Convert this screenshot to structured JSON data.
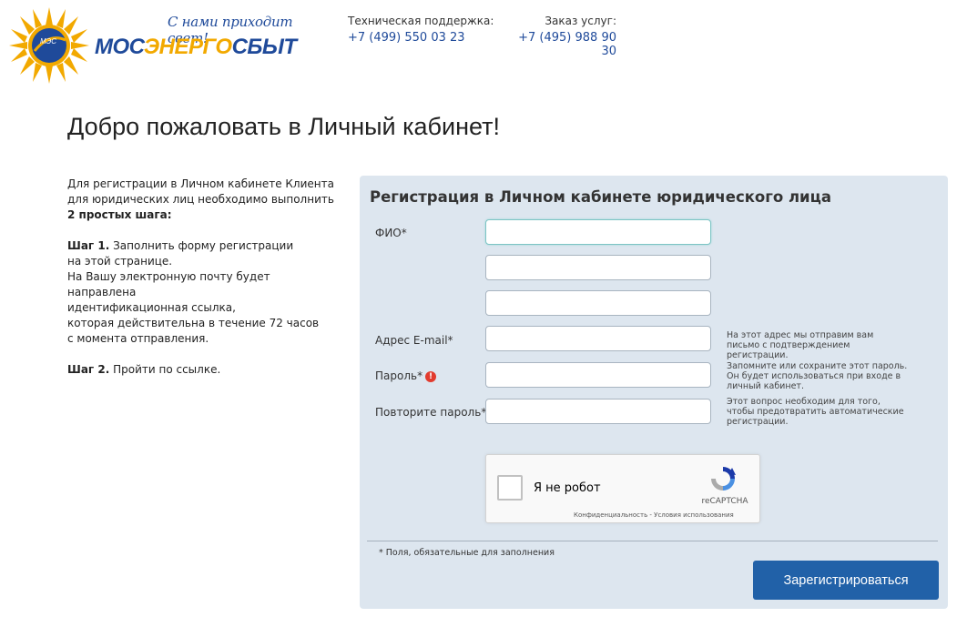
{
  "header": {
    "logo_emblem_text": "МЭС",
    "slogan": "С нами приходит свет!",
    "brand": {
      "part1": "МОС",
      "part2": "ЭНЕРГО",
      "part3": "СБЫТ"
    },
    "support": {
      "label": "Техническая поддержка:",
      "phone": "+7 (499) 550 03 23"
    },
    "order": {
      "label": "Заказ услуг:",
      "phone": "+7 (495) 988 90 30"
    }
  },
  "page_title": "Добро пожаловать в Личный кабинет!",
  "intro": {
    "line1": "Для регистрации в Личном кабинете Клиента",
    "line2": "для юридических лиц необходимо выполнить",
    "line3": "2 простых шага:",
    "step1_label": "Шаг 1.",
    "step1_text1": " Заполнить форму регистрации",
    "step1_text2": "на этой странице.",
    "step1_text3": "На Вашу электронную почту будет направлена",
    "step1_text4": "идентификационная ссылка,",
    "step1_text5": "которая действительна в течение 72 часов",
    "step1_text6": "с момента отправления.",
    "step2_label": "Шаг 2.",
    "step2_text": " Пройти по ссылке."
  },
  "form": {
    "title": "Регистрация в Личном кабинете юридического лица",
    "fio_label": "ФИО*",
    "fio_value": "",
    "fio2_value": "",
    "fio3_value": "",
    "email_label": "Адрес E-mail*",
    "email_value": "",
    "email_hint": "На этот адрес мы отправим вам письмо с подтверждением регистрации.",
    "password_label": "Пароль*",
    "password_value": "",
    "password_hint": "Запомните или сохраните этот пароль. Он будет использоваться при входе в личный кабинет.",
    "password_repeat_label": "Повторите пароль*",
    "password_repeat_value": "",
    "password_repeat_hint": "Этот вопрос необходим для того, чтобы предотвратить автоматические регистрации.",
    "captcha_label": "Я не робот",
    "captcha_brand": "reCAPTCHA",
    "captcha_links": "Конфиденциальность - Условия использования",
    "required_note": "* Поля, обязательные для заполнения",
    "submit_label": "Зарегистрироваться"
  },
  "colors": {
    "brand_blue": "#1f4a9a",
    "brand_yellow": "#f2a900",
    "panel_bg": "#dde6ef",
    "button": "#2161a8"
  }
}
